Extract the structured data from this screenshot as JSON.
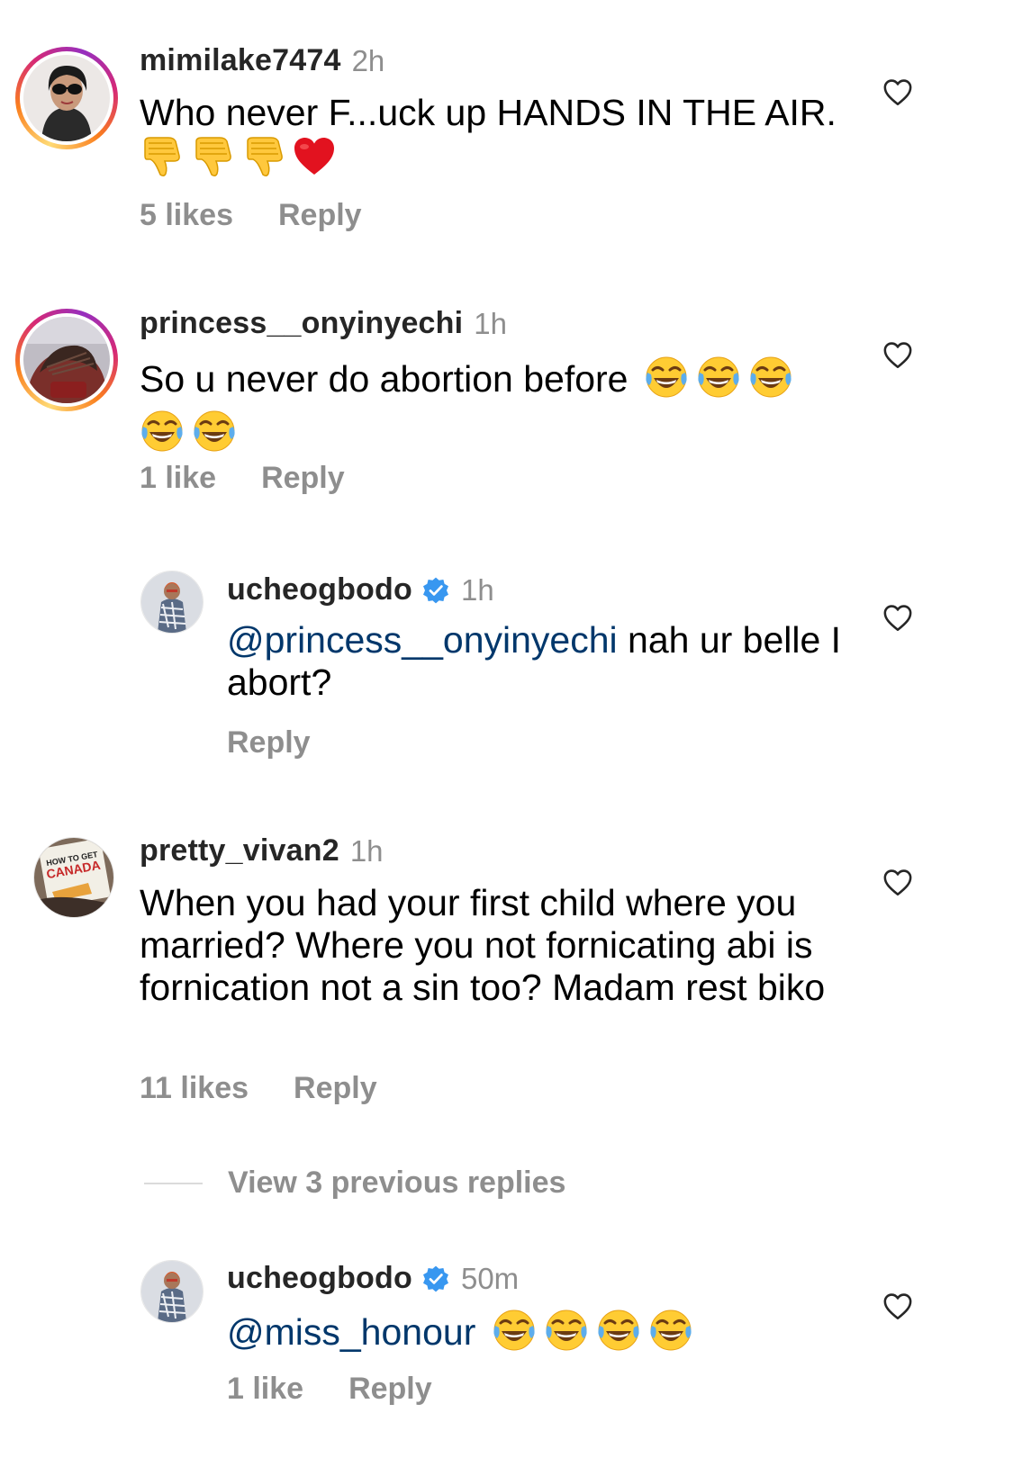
{
  "comments": [
    {
      "username": "mimilake7474",
      "time": "2h",
      "text": "Who never F...uck up HANDS IN THE AIR.",
      "emojis": [
        "thumbs-down",
        "thumbs-down",
        "thumbs-down",
        "red-heart"
      ],
      "likes": "5 likes",
      "reply": "Reply"
    },
    {
      "username": "princess__onyinyechi",
      "time": "1h",
      "text": "So u never do abortion before",
      "emojis": [
        "tears-of-joy",
        "tears-of-joy",
        "tears-of-joy",
        "tears-of-joy",
        "tears-of-joy"
      ],
      "likes": "1 like",
      "reply": "Reply"
    },
    {
      "username": "ucheogbodo",
      "time": "1h",
      "mention": "@princess__onyinyechi",
      "text": " nah ur belle I abort?",
      "reply": "Reply"
    },
    {
      "username": "pretty_vivan2",
      "time": "1h",
      "avatar_text": [
        "HOW TO GET",
        "CANADA"
      ],
      "text": "When you had your first child where you married? Where you not fornicating abi is fornication not a sin too? Madam rest biko",
      "likes": "11 likes",
      "reply": "Reply"
    },
    {
      "username": "ucheogbodo",
      "time": "50m",
      "mention": "@miss_honour",
      "emojis": [
        "tears-of-joy",
        "tears-of-joy",
        "tears-of-joy",
        "tears-of-joy"
      ],
      "likes": "1 like",
      "reply": "Reply"
    }
  ],
  "view_replies": "View 3 previous replies",
  "colors": {
    "verified": "#3897f0",
    "mention": "#00376b",
    "muted": "#8e8e8e"
  }
}
